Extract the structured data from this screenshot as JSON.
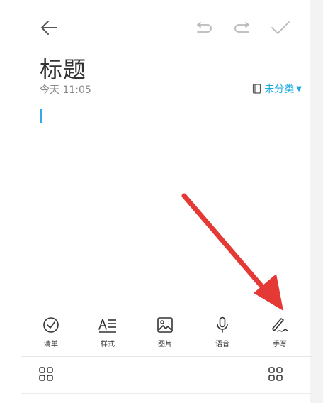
{
  "header": {
    "back_icon": "arrow-left-icon",
    "undo_icon": "undo-icon",
    "redo_icon": "redo-icon",
    "confirm_icon": "check-icon"
  },
  "note": {
    "title": "标题",
    "date": "今天 11:05",
    "category_label": "未分类",
    "category_icon": "notebook-icon"
  },
  "toolbar": {
    "items": [
      {
        "label": "清单",
        "icon": "checklist-icon"
      },
      {
        "label": "样式",
        "icon": "text-style-icon"
      },
      {
        "label": "图片",
        "icon": "image-icon"
      },
      {
        "label": "语音",
        "icon": "microphone-icon"
      },
      {
        "label": "手写",
        "icon": "handwriting-icon"
      }
    ]
  },
  "bottom_bar": {
    "left_icon": "grid-icon",
    "right_icon": "grid-icon"
  },
  "annotation": {
    "arrow_color": "#e53935"
  },
  "colors": {
    "accent": "#17a8e3",
    "text": "#333333",
    "muted": "#888888"
  }
}
